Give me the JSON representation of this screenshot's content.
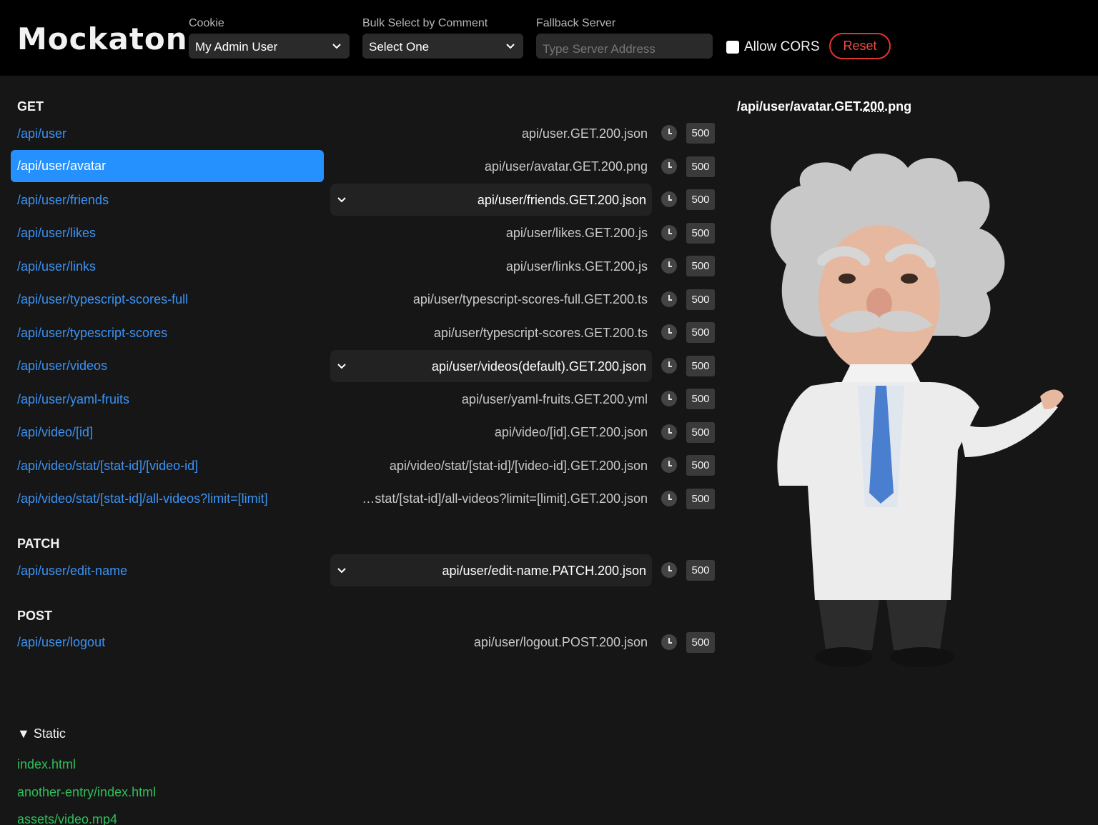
{
  "header": {
    "logo": "Mockaton",
    "cookie": {
      "label": "Cookie",
      "value": "My Admin User"
    },
    "bulk": {
      "label": "Bulk Select by Comment",
      "value": "Select One"
    },
    "fallback": {
      "label": "Fallback Server",
      "placeholder": "Type Server Address"
    },
    "cors_label": "Allow CORS",
    "reset_label": "Reset"
  },
  "groups": {
    "get": {
      "title": "GET",
      "routes": [
        {
          "path": "/api/user",
          "mock": "api/user.GET.200.json",
          "delay": "500"
        },
        {
          "path": "/api/user/avatar",
          "mock": "api/user/avatar.GET.200.png",
          "delay": "500"
        },
        {
          "path": "/api/user/friends",
          "mock": "api/user/friends.GET.200.json",
          "delay": "500"
        },
        {
          "path": "/api/user/likes",
          "mock": "api/user/likes.GET.200.js",
          "delay": "500"
        },
        {
          "path": "/api/user/links",
          "mock": "api/user/links.GET.200.js",
          "delay": "500"
        },
        {
          "path": "/api/user/typescript-scores-full",
          "mock": "api/user/typescript-scores-full.GET.200.ts",
          "delay": "500"
        },
        {
          "path": "/api/user/typescript-scores",
          "mock": "api/user/typescript-scores.GET.200.ts",
          "delay": "500"
        },
        {
          "path": "/api/user/videos",
          "mock": "api/user/videos(default).GET.200.json",
          "delay": "500"
        },
        {
          "path": "/api/user/yaml-fruits",
          "mock": "api/user/yaml-fruits.GET.200.yml",
          "delay": "500"
        },
        {
          "path": "/api/video/[id]",
          "mock": "api/video/[id].GET.200.json",
          "delay": "500"
        },
        {
          "path": "/api/video/stat/[stat-id]/[video-id]",
          "mock": "api/video/stat/[stat-id]/[video-id].GET.200.json",
          "delay": "500"
        },
        {
          "path": "/api/video/stat/[stat-id]/all-videos?limit=[limit]",
          "mock": "…stat/[stat-id]/all-videos?limit=[limit].GET.200.json",
          "delay": "500"
        }
      ]
    },
    "patch": {
      "title": "PATCH",
      "routes": [
        {
          "path": "/api/user/edit-name",
          "mock": "api/user/edit-name.PATCH.200.json",
          "delay": "500"
        }
      ]
    },
    "post": {
      "title": "POST",
      "routes": [
        {
          "path": "/api/user/logout",
          "mock": "api/user/logout.POST.200.json",
          "delay": "500"
        }
      ]
    }
  },
  "preview": {
    "title_prefix": "/api/user/avatar.GET.",
    "title_code": "200",
    "title_suffix": ".png"
  },
  "static": {
    "title": "▼ Static",
    "files": [
      "index.html",
      "another-entry/index.html",
      "assets/video.mp4"
    ]
  },
  "colors": {
    "accent": "#2491ff",
    "link": "#3b93f5",
    "static_link": "#2fbf5a",
    "reset": "#e0352b"
  }
}
